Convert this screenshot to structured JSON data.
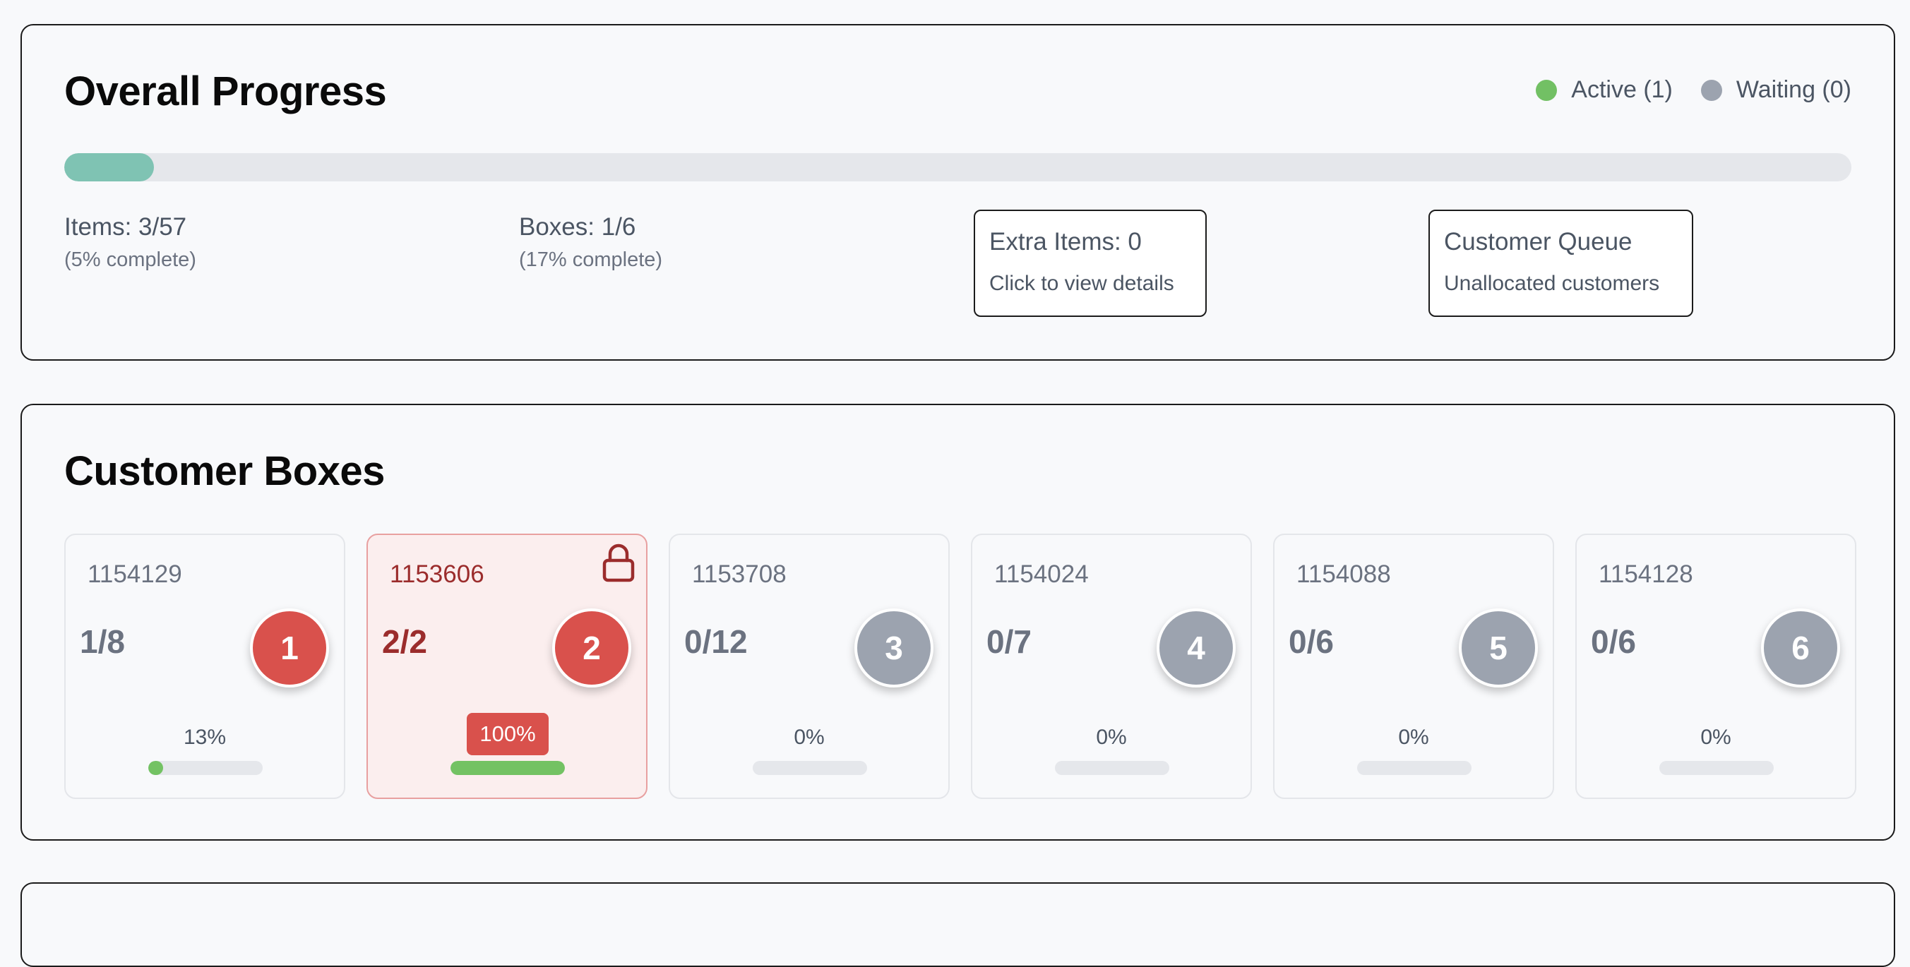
{
  "colors": {
    "active": "#72c064",
    "waiting": "#9ca3af",
    "accent_red": "#d9514c",
    "progress_teal": "#7fc3b3",
    "mini_progress_green": "#73c263"
  },
  "overall": {
    "title": "Overall Progress",
    "legend": {
      "active_label": "Active (1)",
      "waiting_label": "Waiting (0)"
    },
    "progress_fraction": 0.05,
    "items": {
      "label": "Items: 3/57",
      "sub": "(5% complete)"
    },
    "boxes": {
      "label": "Boxes: 1/6",
      "sub": "(17% complete)"
    },
    "extra_items": {
      "title": "Extra Items: 0",
      "sub": "Click to view details"
    },
    "customer_queue": {
      "title": "Customer Queue",
      "sub": "Unallocated customers"
    }
  },
  "customer_boxes": {
    "title": "Customer Boxes",
    "boxes": [
      {
        "id": "1154129",
        "count": "1/8",
        "number": "1",
        "percent_label": "13%",
        "fill": 0.13,
        "state": "active",
        "locked": false
      },
      {
        "id": "1153606",
        "count": "2/2",
        "number": "2",
        "percent_label": "100%",
        "fill": 1.0,
        "state": "active",
        "locked": true,
        "lock_icon": "lock-icon"
      },
      {
        "id": "1153708",
        "count": "0/12",
        "number": "3",
        "percent_label": "0%",
        "fill": 0,
        "state": "waiting",
        "locked": false
      },
      {
        "id": "1154024",
        "count": "0/7",
        "number": "4",
        "percent_label": "0%",
        "fill": 0,
        "state": "waiting",
        "locked": false
      },
      {
        "id": "1154088",
        "count": "0/6",
        "number": "5",
        "percent_label": "0%",
        "fill": 0,
        "state": "waiting",
        "locked": false
      },
      {
        "id": "1154128",
        "count": "0/6",
        "number": "6",
        "percent_label": "0%",
        "fill": 0,
        "state": "waiting",
        "locked": false
      }
    ]
  }
}
